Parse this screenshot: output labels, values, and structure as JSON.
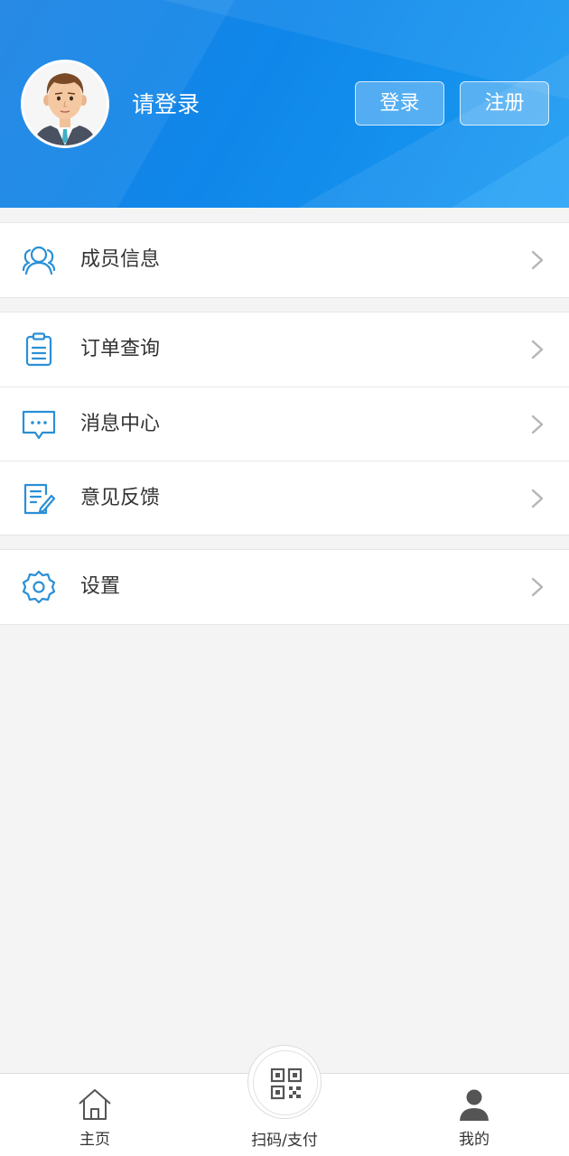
{
  "header": {
    "login_prompt": "请登录",
    "login_button": "登录",
    "register_button": "注册",
    "background_color": "#1b83e3"
  },
  "menu": {
    "groups": [
      {
        "items": [
          {
            "label": "成员信息",
            "icon": "members-icon"
          }
        ]
      },
      {
        "items": [
          {
            "label": "订单查询",
            "icon": "clipboard-icon"
          },
          {
            "label": "消息中心",
            "icon": "message-icon"
          },
          {
            "label": "意见反馈",
            "icon": "feedback-icon"
          }
        ]
      },
      {
        "items": [
          {
            "label": "设置",
            "icon": "gear-icon"
          }
        ]
      }
    ],
    "icon_color": "#2a8fd6"
  },
  "tabbar": {
    "home": "主页",
    "scan": "扫码/支付",
    "mine": "我的"
  }
}
